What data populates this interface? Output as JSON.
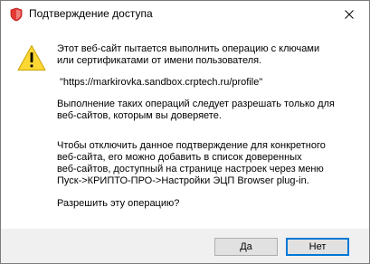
{
  "window": {
    "title": "Подтверждение доступа",
    "close_glyph": "✕",
    "title_icon": "shield-icon"
  },
  "message": {
    "icon": "warning-icon",
    "icon_colors": {
      "fill": "#fdd835",
      "border": "#c8a200",
      "mark": "#000000"
    },
    "line1": "Этот веб-сайт пытается выполнить операцию с ключами",
    "line2": "или сертификатами от имени пользователя.",
    "url": "\"https://markirovka.sandbox.crptech.ru/profile\"",
    "para2_line1": "Выполнение таких операций следует разрешать только для",
    "para2_line2": "веб-сайтов, которым вы доверяете.",
    "para3_line1": "Чтобы отключить данное подтверждение для конкретного",
    "para3_line2": "веб-сайта, его можно добавить в список доверенных",
    "para3_line3": "веб-сайтов, доступный на странице настроек через меню",
    "para3_line4": "Пуск->КРИПТО-ПРО->Настройки ЭЦП Browser plug-in.",
    "question": "Разрешить эту операцию?"
  },
  "buttons": {
    "yes_label": "Да",
    "no_label": "Нет",
    "default_border_color": "#0078d7"
  }
}
